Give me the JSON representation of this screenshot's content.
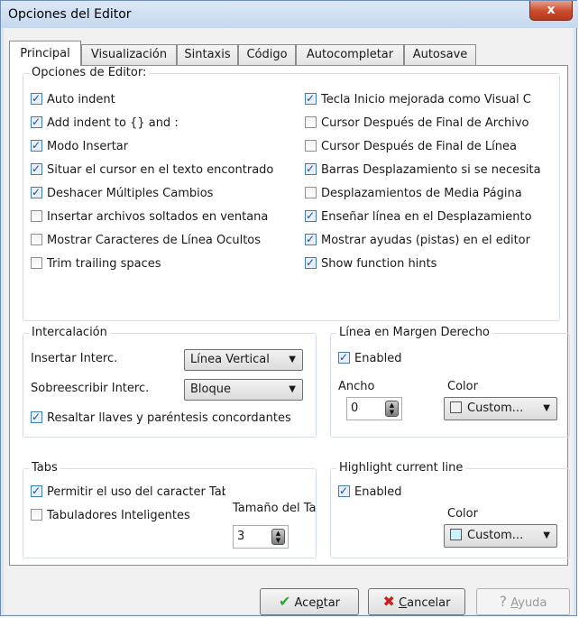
{
  "window": {
    "title": "Opciones del Editor",
    "close_glyph": "x"
  },
  "tabs": [
    {
      "label": "Principal"
    },
    {
      "label": "Visualización"
    },
    {
      "label": "Sintaxis"
    },
    {
      "label": "Código"
    },
    {
      "label": "Autocompletar"
    },
    {
      "label": "Autosave"
    }
  ],
  "editor_options": {
    "legend": "Opciones de Editor:",
    "left": [
      {
        "label": "Auto indent",
        "checked": true
      },
      {
        "label": "Add indent to {} and :",
        "checked": true
      },
      {
        "label": "Modo Insertar",
        "checked": true
      },
      {
        "label": "Situar el cursor en el texto encontrado",
        "checked": true
      },
      {
        "label": "Deshacer Múltiples Cambios",
        "checked": true
      },
      {
        "label": "Insertar archivos soltados en ventana",
        "checked": false
      },
      {
        "label": "Mostrar Caracteres de Línea Ocultos",
        "checked": false
      },
      {
        "label": "Trim trailing spaces",
        "checked": false
      }
    ],
    "right": [
      {
        "label": "Tecla Inicio mejorada como Visual C",
        "checked": true
      },
      {
        "label": "Cursor Después de Final de Archivo",
        "checked": false
      },
      {
        "label": "Cursor Después de Final de Línea",
        "checked": false
      },
      {
        "label": "Barras Desplazamiento si se necesita",
        "checked": true
      },
      {
        "label": "Desplazamientos de Media Página",
        "checked": false
      },
      {
        "label": "Enseñar línea en el Desplazamiento",
        "checked": true
      },
      {
        "label": "Mostrar ayudas (pistas) en el editor",
        "checked": true
      },
      {
        "label": "Show function hints",
        "checked": true
      }
    ]
  },
  "caret": {
    "legend": "Intercalación",
    "insert_label": "Insertar Interc.",
    "insert_value": "Línea Vertical",
    "overwrite_label": "Sobreescribir Interc.",
    "overwrite_value": "Bloque",
    "highlight_braces": {
      "label": "Resaltar llaves y paréntesis concordantes",
      "checked": true
    }
  },
  "right_margin": {
    "legend": "Línea en Margen Derecho",
    "enabled": {
      "label": "Enabled",
      "checked": true
    },
    "width_label": "Ancho",
    "width_value": "0",
    "color_label": "Color",
    "color_value": "Custom...",
    "swatch_color": "#f0f0f0"
  },
  "tabs_group": {
    "legend": "Tabs",
    "allow_tab": {
      "label": "Permitir el uso del caracter Tab",
      "checked": true
    },
    "smart_tabs": {
      "label": "Tabuladores Inteligentes",
      "checked": false
    },
    "size_label": "Tamaño del Tab",
    "size_value": "3"
  },
  "highlight_line": {
    "legend": "Highlight current line",
    "enabled": {
      "label": "Enabled",
      "checked": true
    },
    "color_label": "Color",
    "color_value": "Custom...",
    "swatch_color": "#ccf2ff"
  },
  "footer": {
    "ok_pre": "Ace",
    "ok_key": "p",
    "ok_post": "tar",
    "cancel_key": "C",
    "cancel_post": "ancelar",
    "help_key": "A",
    "help_post": "yuda"
  },
  "colors": {
    "check_accent": "#1d4fa0",
    "ok_icon": "#3aa03a",
    "cancel_icon": "#c8221a"
  }
}
